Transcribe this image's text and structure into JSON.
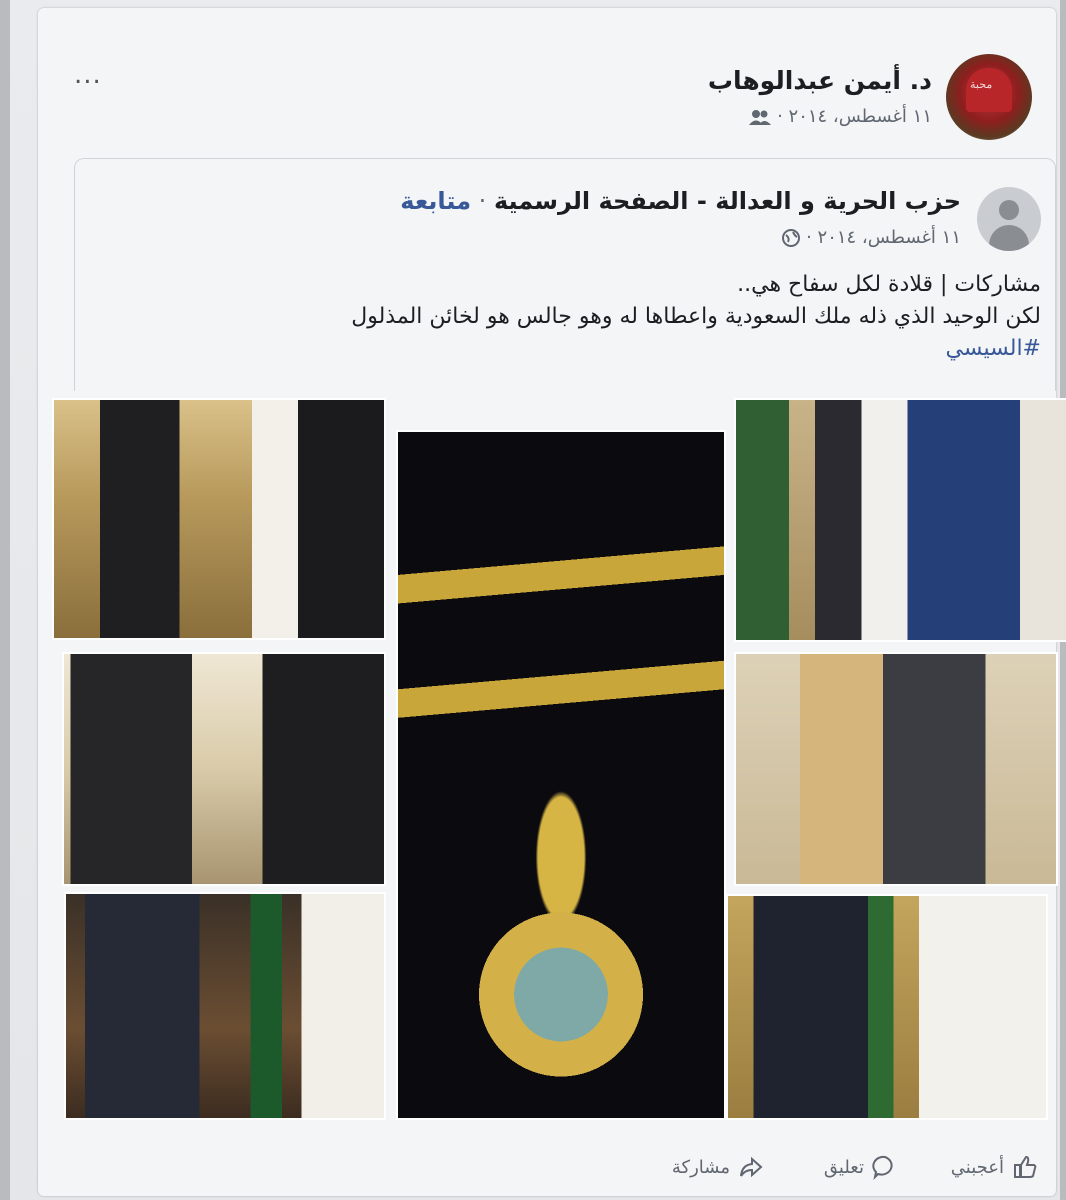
{
  "post": {
    "author_name": "د. أيمن عبدالوهاب",
    "date": "١١ أغسطس، ٢٠١٤ ·",
    "more_label": "...",
    "avatar_text": "محبة"
  },
  "shared": {
    "page_name": "حزب الحرية و العدالة - الصفحة الرسمية",
    "separator": " · ",
    "follow_label": "متابعة",
    "date": "١١ أغسطس، ٢٠١٤ ·",
    "text_line1": "مشاركات | قلادة لكل سفاح هي..",
    "text_line2": "لكن الوحيد الذي ذله ملك السعودية واعطاها له وهو جالس  هو لخائن المذلول",
    "hashtag": "#السيسي"
  },
  "actions": {
    "like": "أعجبني",
    "comment": "تعليق",
    "share": "مشاركة"
  },
  "icons": {
    "friends": "friends-icon",
    "globe": "globe-icon",
    "like": "thumbs-up-icon",
    "comment": "comment-icon",
    "share": "share-arrow-icon"
  }
}
